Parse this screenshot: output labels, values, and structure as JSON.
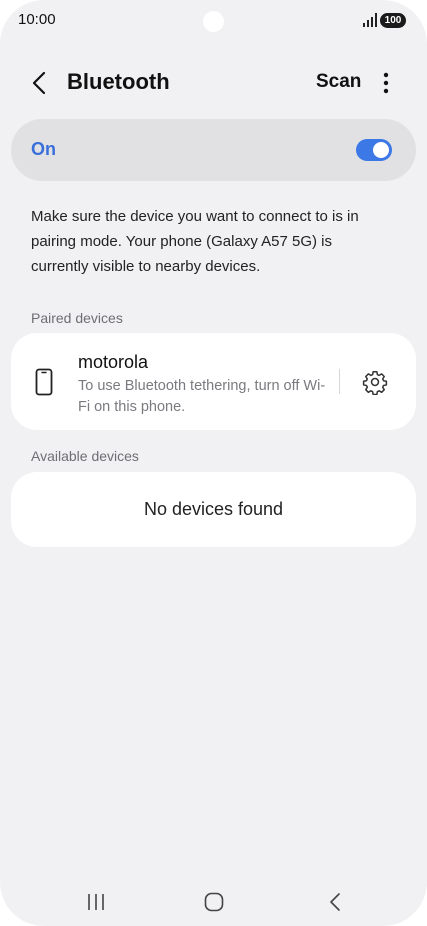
{
  "status_bar": {
    "time": "10:00",
    "battery": "100"
  },
  "header": {
    "title": "Bluetooth",
    "scan_label": "Scan"
  },
  "master_switch": {
    "label": "On",
    "checked": true,
    "accent_color": "#3c78e6"
  },
  "info_text": "Make sure the device you want to connect to is in pairing mode. Your phone (Galaxy A57 5G) is currently visible to nearby devices.",
  "paired": {
    "header": "Paired devices",
    "devices": [
      {
        "name": "motorola",
        "description": "To use Bluetooth tethering, turn off Wi-Fi on this phone.",
        "icon": "smartphone-icon"
      }
    ]
  },
  "available": {
    "header": "Available devices",
    "empty_text": "No devices found"
  },
  "icons": {
    "back": "chevron-left-icon",
    "more": "more-vertical-icon",
    "settings": "gear-icon",
    "nav_recent": "recent-apps-icon",
    "nav_home": "home-icon",
    "nav_back": "back-icon"
  }
}
